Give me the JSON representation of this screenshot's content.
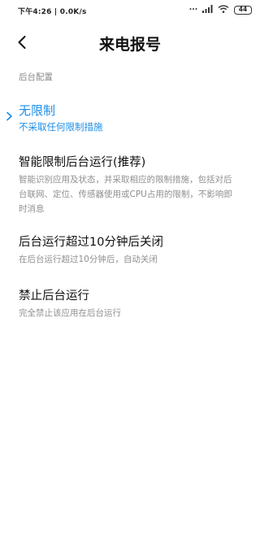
{
  "status_bar": {
    "left_text": "下午4:26 | 0.0K/s",
    "icons": [
      "dots-icon",
      "signal-icon",
      "wifi-icon"
    ],
    "battery": "44"
  },
  "header": {
    "back_icon": "chevron-left-icon",
    "title": "来电报号"
  },
  "section": {
    "label": "后台配置"
  },
  "options": [
    {
      "title": "无限制",
      "desc": "不采取任何限制措施",
      "selected": true
    },
    {
      "title": "智能限制后台运行(推荐)",
      "desc": "智能识别应用及状态，并采取相应的限制措施，包括对后台联网、定位、传感器使用或CPU占用的限制，不影响即时消息",
      "selected": false
    },
    {
      "title": "后台运行超过10分钟后关闭",
      "desc": "在后台运行超过10分钟后，自动关闭",
      "selected": false
    },
    {
      "title": "禁止后台运行",
      "desc": "完全禁止该应用在后台运行",
      "selected": false
    }
  ],
  "colors": {
    "accent": "#1a8ee8",
    "text": "#111111",
    "muted": "#8f8f8f"
  }
}
